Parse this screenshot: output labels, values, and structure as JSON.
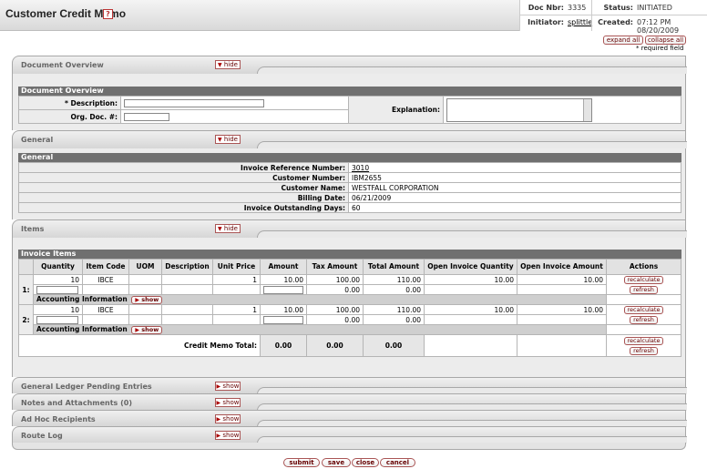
{
  "header": {
    "title": "Customer Credit Memo",
    "help": "?",
    "doc_nbr_label": "Doc Nbr:",
    "doc_nbr": "3335",
    "status_label": "Status:",
    "status": "INITIATED",
    "initiator_label": "Initiator:",
    "initiator": "splittle",
    "created_label": "Created:",
    "created": "07:12 PM 08/20/2009"
  },
  "controls": {
    "expand_all": "expand all",
    "collapse_all": "collapse all",
    "required_note": "* required field"
  },
  "tabs": {
    "document_overview": {
      "label": "Document Overview",
      "button": "hide"
    },
    "general": {
      "label": "General",
      "button": "hide"
    },
    "items": {
      "label": "Items",
      "button": "hide"
    },
    "gl_pending": {
      "label": "General Ledger Pending Entries",
      "button": "show"
    },
    "notes": {
      "label": "Notes and Attachments (0)",
      "button": "show"
    },
    "adhoc": {
      "label": "Ad Hoc Recipients",
      "button": "show"
    },
    "route_log": {
      "label": "Route Log",
      "button": "show"
    }
  },
  "document_overview": {
    "heading": "Document Overview",
    "description_label": "* Description:",
    "description_value": "",
    "org_doc_label": "Org. Doc. #:",
    "org_doc_value": "",
    "explanation_label": "Explanation:",
    "explanation_value": ""
  },
  "general": {
    "heading": "General",
    "invoice_ref_label": "Invoice Reference Number:",
    "invoice_ref": "3010",
    "customer_number_label": "Customer Number:",
    "customer_number": "IBM2655",
    "customer_name_label": "Customer Name:",
    "customer_name": "WESTFALL CORPORATION",
    "billing_date_label": "Billing Date:",
    "billing_date": "06/21/2009",
    "outstanding_days_label": "Invoice Outstanding Days:",
    "outstanding_days": "60"
  },
  "items": {
    "heading": "Invoice Items",
    "columns": [
      "Quantity",
      "Item Code",
      "UOM",
      "Description",
      "Unit Price",
      "Amount",
      "Tax Amount",
      "Total Amount",
      "Open Invoice Quantity",
      "Open Invoice Amount",
      "Actions"
    ],
    "rows": [
      {
        "num": "1:",
        "qty": "10",
        "code": "IBCE",
        "uom": "",
        "desc": "",
        "price": "1",
        "amount": "10.00",
        "tax": "100.00",
        "total": "110.00",
        "open_qty": "10.00",
        "open_amt": "10.00",
        "tax2": "0.00",
        "total2": "0.00"
      },
      {
        "num": "2:",
        "qty": "10",
        "code": "IBCE",
        "uom": "",
        "desc": "",
        "price": "1",
        "amount": "10.00",
        "tax": "100.00",
        "total": "110.00",
        "open_qty": "10.00",
        "open_amt": "10.00",
        "tax2": "0.00",
        "total2": "0.00"
      }
    ],
    "accounting_label": "Accounting Information",
    "show": "show",
    "recalculate": "recalculate",
    "refresh": "refresh",
    "total_label": "Credit Memo Total:",
    "total_amount": "0.00",
    "total_tax": "0.00",
    "total_total": "0.00"
  },
  "footer": {
    "submit": "submit",
    "save": "save",
    "close": "close",
    "cancel": "cancel"
  }
}
